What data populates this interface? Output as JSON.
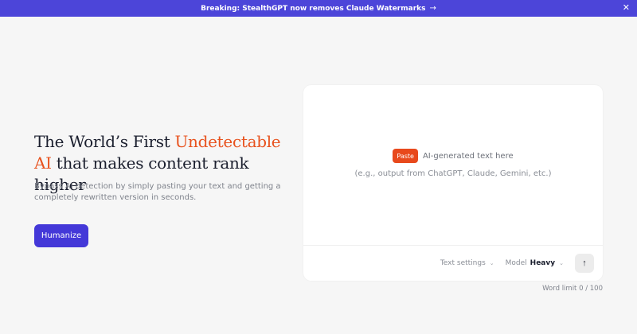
{
  "banner": {
    "text": "Breaking: StealthGPT now removes Claude Watermarks",
    "arrow": "→",
    "close": "✕"
  },
  "hero": {
    "title_part1": "The World’s First ",
    "title_accent": "Undetectable AI",
    "title_part2": " that makes content rank higher",
    "subtitle": "Bypass AI detection by simply pasting your text and getting a completely rewritten version in seconds.",
    "cta_label": "Humanize"
  },
  "editor": {
    "paste_label": "Paste",
    "prompt": "AI-generated text here",
    "hint": "(e.g., output from ChatGPT, Claude, Gemini, etc.)",
    "text_settings_label": "Text settings",
    "model_label": "Model",
    "model_value": "Heavy",
    "chevron": "⌄",
    "send_icon": "↑"
  },
  "word_limit": "Word limit 0 / 100",
  "colors": {
    "banner": "#4c45d9",
    "accent": "#e8521e",
    "cta": "#4438d8",
    "paste": "#e8491c"
  }
}
